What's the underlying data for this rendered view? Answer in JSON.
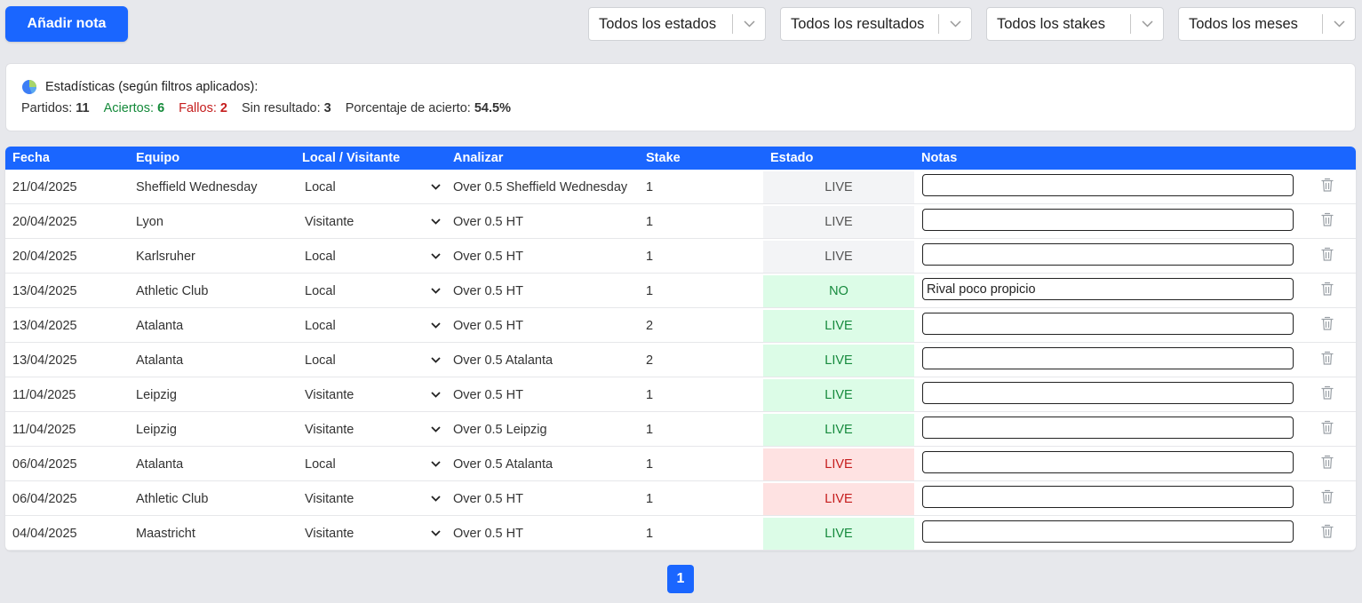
{
  "toolbar": {
    "add_label": "Añadir nota"
  },
  "filters": [
    {
      "label": "Todos los estados"
    },
    {
      "label": "Todos los resultados"
    },
    {
      "label": "Todos los stakes"
    },
    {
      "label": "Todos los meses"
    }
  ],
  "stats": {
    "title": "Estadísticas (según filtros aplicados):",
    "items": [
      {
        "label": "Partidos:",
        "value": "11",
        "tone": "default"
      },
      {
        "label": "Aciertos:",
        "value": "6",
        "tone": "green"
      },
      {
        "label": "Fallos:",
        "value": "2",
        "tone": "red"
      },
      {
        "label": "Sin resultado:",
        "value": "3",
        "tone": "default"
      },
      {
        "label": "Porcentaje de acierto:",
        "value": "54.5%",
        "tone": "default"
      }
    ]
  },
  "table": {
    "headers": [
      "Fecha",
      "Equipo",
      "Local / Visitante",
      "Analizar",
      "Stake",
      "Estado",
      "Notas"
    ],
    "rows": [
      {
        "fecha": "21/04/2025",
        "equipo": "Sheffield Wednesday",
        "lv": "Local",
        "analizar": "Over 0.5 Sheffield Wednesday",
        "stake": "1",
        "estado": "LIVE",
        "tone": "neutral",
        "nota": ""
      },
      {
        "fecha": "20/04/2025",
        "equipo": "Lyon",
        "lv": "Visitante",
        "analizar": "Over 0.5 HT",
        "stake": "1",
        "estado": "LIVE",
        "tone": "neutral",
        "nota": ""
      },
      {
        "fecha": "20/04/2025",
        "equipo": "Karlsruher",
        "lv": "Local",
        "analizar": "Over 0.5 HT",
        "stake": "1",
        "estado": "LIVE",
        "tone": "neutral",
        "nota": ""
      },
      {
        "fecha": "13/04/2025",
        "equipo": "Athletic Club",
        "lv": "Local",
        "analizar": "Over 0.5 HT",
        "stake": "1",
        "estado": "NO",
        "tone": "green",
        "nota": "Rival poco propicio"
      },
      {
        "fecha": "13/04/2025",
        "equipo": "Atalanta",
        "lv": "Local",
        "analizar": "Over 0.5 HT",
        "stake": "2",
        "estado": "LIVE",
        "tone": "green",
        "nota": ""
      },
      {
        "fecha": "13/04/2025",
        "equipo": "Atalanta",
        "lv": "Local",
        "analizar": "Over 0.5 Atalanta",
        "stake": "2",
        "estado": "LIVE",
        "tone": "green",
        "nota": ""
      },
      {
        "fecha": "11/04/2025",
        "equipo": "Leipzig",
        "lv": "Visitante",
        "analizar": "Over 0.5 HT",
        "stake": "1",
        "estado": "LIVE",
        "tone": "green",
        "nota": ""
      },
      {
        "fecha": "11/04/2025",
        "equipo": "Leipzig",
        "lv": "Visitante",
        "analizar": "Over 0.5 Leipzig",
        "stake": "1",
        "estado": "LIVE",
        "tone": "green",
        "nota": ""
      },
      {
        "fecha": "06/04/2025",
        "equipo": "Atalanta",
        "lv": "Local",
        "analizar": "Over 0.5 Atalanta",
        "stake": "1",
        "estado": "LIVE",
        "tone": "red",
        "nota": ""
      },
      {
        "fecha": "06/04/2025",
        "equipo": "Athletic Club",
        "lv": "Visitante",
        "analizar": "Over 0.5 HT",
        "stake": "1",
        "estado": "LIVE",
        "tone": "red",
        "nota": ""
      },
      {
        "fecha": "04/04/2025",
        "equipo": "Maastricht",
        "lv": "Visitante",
        "analizar": "Over 0.5 HT",
        "stake": "1",
        "estado": "LIVE",
        "tone": "green",
        "nota": ""
      }
    ]
  },
  "pagination": {
    "current": "1"
  },
  "icons": {
    "stats": "pie-chart-icon",
    "delete": "trash-icon",
    "dropdown": "chevron-down-icon"
  },
  "colors": {
    "primary": "#1a66ff",
    "success": "#148a3a",
    "danger": "#c51d1d"
  }
}
